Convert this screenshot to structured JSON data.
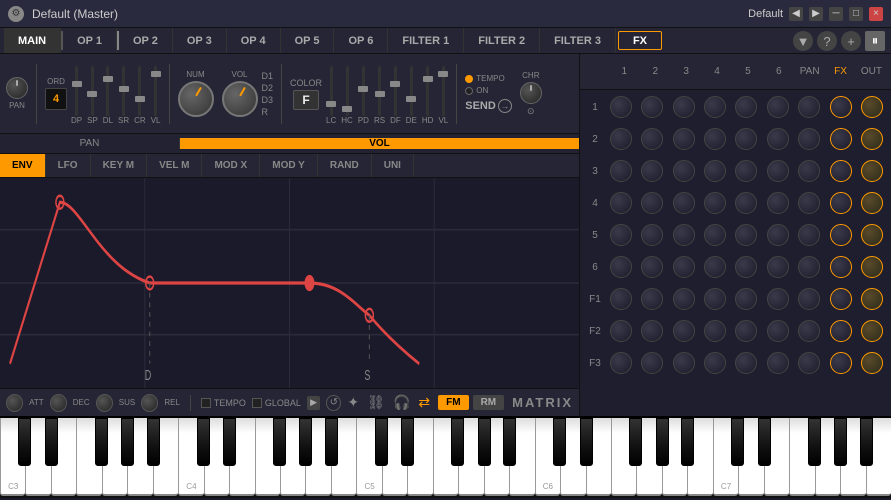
{
  "titleBar": {
    "title": "Default (Master)",
    "defaultLabel": "Default",
    "prevArrow": "◀",
    "nextArrow": "▶",
    "minimizeLabel": "─",
    "maximizeLabel": "□",
    "closeLabel": "×"
  },
  "navTabs": {
    "tabs": [
      "MAIN",
      "OP 1",
      "OP 2",
      "OP 3",
      "OP 4",
      "OP 5",
      "OP 6",
      "FILTER 1",
      "FILTER 2",
      "FILTER 3"
    ],
    "fxLabel": "FX",
    "activeTab": "FX"
  },
  "controls": {
    "panLabel": "PAN",
    "ordLabel": "ORD",
    "dpLabel": "DP",
    "spLabel": "SP",
    "dlLabel": "DL",
    "srLabel": "SR",
    "crLabel": "CR",
    "vlLabel": "VL",
    "numLabel": "NUM",
    "volLabel": "VOL",
    "d1Label": "D1",
    "d2Label": "D2",
    "d3Label": "D3",
    "rLabel": "R",
    "colorLabel": "COLOR",
    "colorValue": "F",
    "lcLabel": "LC",
    "hcLabel": "HC",
    "pdLabel": "PD",
    "rsLabel": "RS",
    "dfLabel": "DF",
    "deLabel": "DE",
    "hdLabel": "HD",
    "vlLabel2": "VL",
    "ordValue": "4",
    "sendLabel": "SEND",
    "tempoLabel": "TEMPO",
    "onLabel": "ON",
    "chrLabel": "CHR"
  },
  "panVol": {
    "panLabel": "PAN",
    "volLabel": "VOL"
  },
  "modTabs": {
    "tabs": [
      "ENV",
      "LFO",
      "KEY M",
      "VEL M",
      "MOD X",
      "MOD Y",
      "RAND",
      "UNI"
    ],
    "activeTab": "ENV"
  },
  "bottomControls": {
    "attLabel": "ATT",
    "decLabel": "DEC",
    "susLabel": "SUS",
    "relLabel": "REL",
    "tempoLabel": "TEMPO",
    "globalLabel": "GLOBAL",
    "fmLabel": "FM",
    "rmLabel": "RM",
    "matrixLabel": "MATRIX"
  },
  "matrix": {
    "colLabels": [
      "1",
      "2",
      "3",
      "4",
      "5",
      "6",
      "PAN",
      "FX",
      "OUT"
    ],
    "rowLabels": [
      "1",
      "2",
      "3",
      "4",
      "5",
      "6",
      "F1",
      "F2",
      "F3"
    ]
  }
}
